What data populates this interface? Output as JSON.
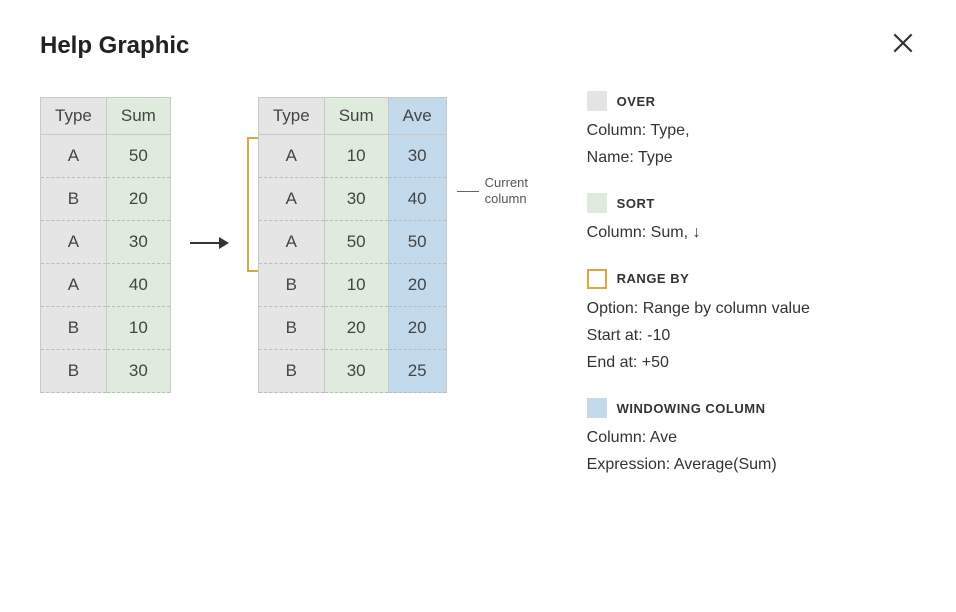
{
  "title": "Help Graphic",
  "annotation": "Current column",
  "table1": {
    "headers": [
      "Type",
      "Sum"
    ],
    "rows": [
      [
        "A",
        "50"
      ],
      [
        "B",
        "20"
      ],
      [
        "A",
        "30"
      ],
      [
        "A",
        "40"
      ],
      [
        "B",
        "10"
      ],
      [
        "B",
        "30"
      ]
    ]
  },
  "table2": {
    "headers": [
      "Type",
      "Sum",
      "Ave"
    ],
    "rows": [
      [
        "A",
        "10",
        "30"
      ],
      [
        "A",
        "30",
        "40"
      ],
      [
        "A",
        "50",
        "50"
      ],
      [
        "B",
        "10",
        "20"
      ],
      [
        "B",
        "20",
        "20"
      ],
      [
        "B",
        "30",
        "25"
      ]
    ]
  },
  "legend": {
    "over": {
      "title": "OVER",
      "lines": [
        "Column: Type,",
        "Name: Type"
      ]
    },
    "sort": {
      "title": "SORT",
      "lines": [
        "Column: Sum, ↓"
      ]
    },
    "range": {
      "title": "RANGE BY",
      "lines": [
        "Option: Range by column value",
        "Start at: -10",
        "End at: +50"
      ]
    },
    "window": {
      "title": "WINDOWING COLUMN",
      "lines": [
        "Column: Ave",
        "Expression: Average(Sum)"
      ]
    }
  }
}
